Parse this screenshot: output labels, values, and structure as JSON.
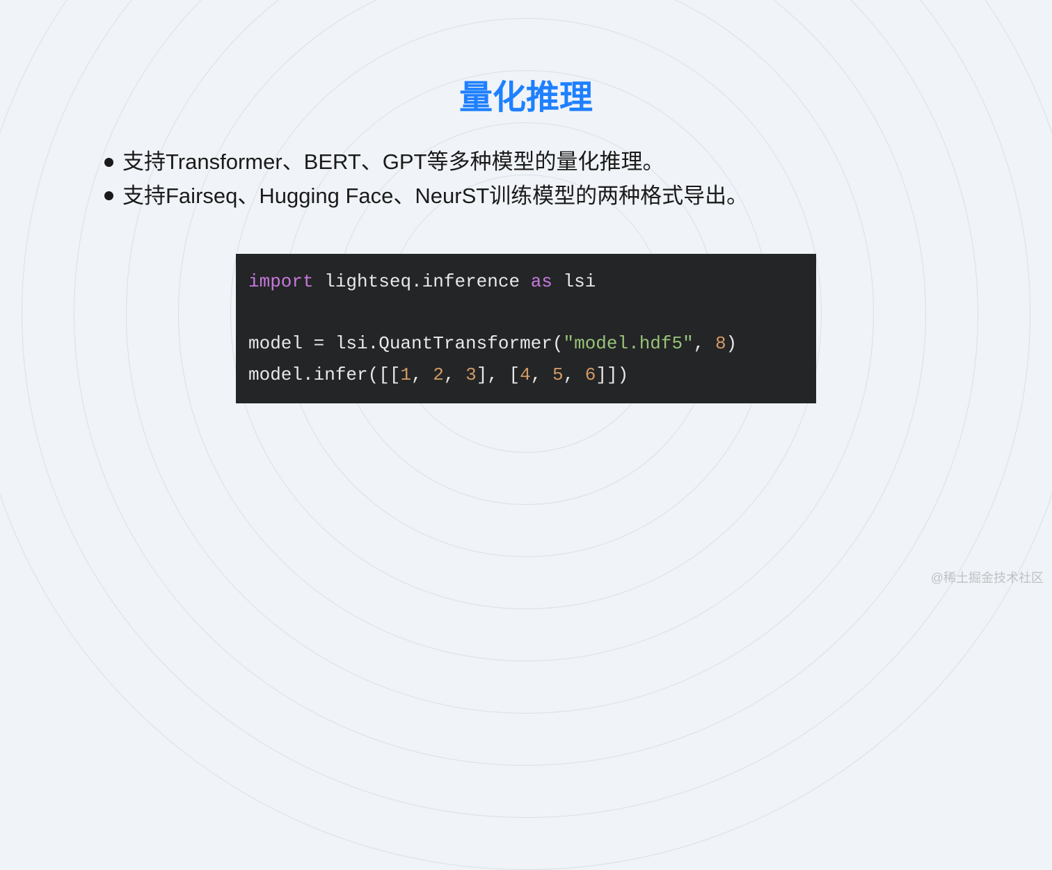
{
  "title": "量化推理",
  "bullets": [
    "支持Transformer、BERT、GPT等多种模型的量化推理。",
    "支持Fairseq、Hugging Face、NeurST训练模型的两种格式导出。"
  ],
  "code": {
    "line1": {
      "import": "import",
      "module": " lightseq.inference ",
      "as": "as",
      "alias": " lsi"
    },
    "line3_prefix": "model = lsi.QuantTransformer(",
    "line3_str": "\"model.hdf5\"",
    "line3_comma": ", ",
    "line3_num": "8",
    "line3_suffix": ")",
    "line4_prefix": "model.infer([[",
    "line4_n1": "1",
    "line4_c1": ", ",
    "line4_n2": "2",
    "line4_c2": ", ",
    "line4_n3": "3",
    "line4_mid": "], [",
    "line4_n4": "4",
    "line4_c3": ", ",
    "line4_n5": "5",
    "line4_c4": ", ",
    "line4_n6": "6",
    "line4_suffix": "]])"
  },
  "watermark": "@稀土掘金技术社区"
}
